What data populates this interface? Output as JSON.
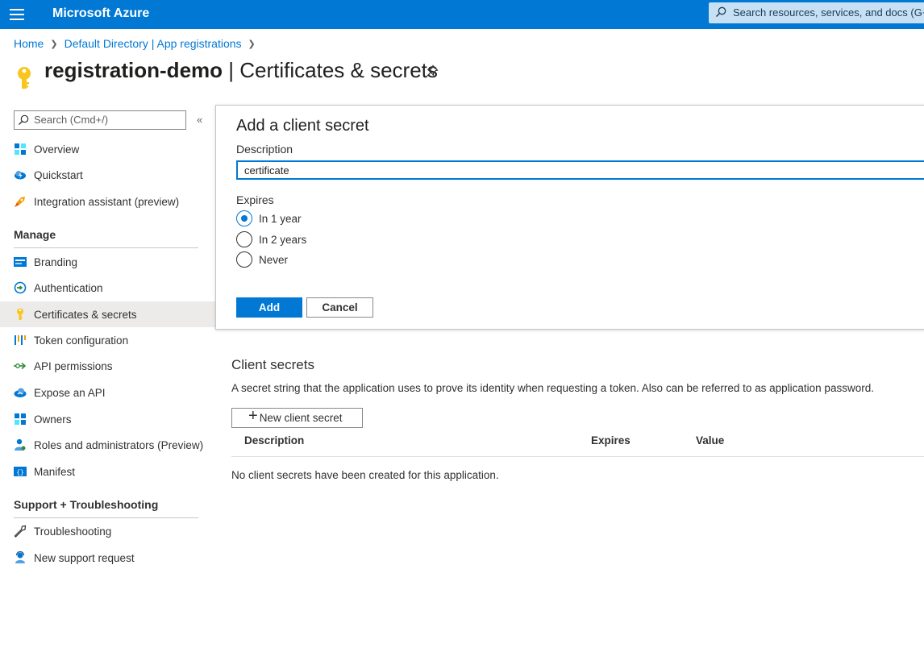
{
  "topbar": {
    "brand": "Microsoft Azure",
    "search_placeholder": "Search resources, services, and docs (G+/)"
  },
  "breadcrumb": [
    "Home",
    "Default Directory | App registrations"
  ],
  "header": {
    "app_name": "registration-demo",
    "separator": "|",
    "page_name": "Certificates & secrets"
  },
  "sidebar": {
    "search_placeholder": "Search (Cmd+/)",
    "collapse_glyph": "«",
    "top_items": [
      {
        "label": "Overview",
        "icon": "overview-grid-icon"
      },
      {
        "label": "Quickstart",
        "icon": "cloud-lightning-icon"
      },
      {
        "label": "Integration assistant (preview)",
        "icon": "rocket-icon"
      }
    ],
    "manage_header": "Manage",
    "manage_items": [
      {
        "label": "Branding",
        "icon": "branding-icon"
      },
      {
        "label": "Authentication",
        "icon": "authentication-icon"
      },
      {
        "label": "Certificates & secrets",
        "icon": "key-icon",
        "active": true
      },
      {
        "label": "Token configuration",
        "icon": "token-bars-icon"
      },
      {
        "label": "API permissions",
        "icon": "api-arrow-icon"
      },
      {
        "label": "Expose an API",
        "icon": "cloud-api-icon"
      },
      {
        "label": "Owners",
        "icon": "owners-grid-icon"
      },
      {
        "label": "Roles and administrators (Preview)",
        "icon": "person-badge-icon"
      },
      {
        "label": "Manifest",
        "icon": "manifest-icon"
      }
    ],
    "support_header": "Support + Troubleshooting",
    "support_items": [
      {
        "label": "Troubleshooting",
        "icon": "wrench-icon"
      },
      {
        "label": "New support request",
        "icon": "support-person-icon"
      }
    ]
  },
  "panel": {
    "title": "Add a client secret",
    "description_label": "Description",
    "description_value": "certificate",
    "expires_label": "Expires",
    "options": [
      {
        "label": "In 1 year",
        "checked": true
      },
      {
        "label": "In 2 years",
        "checked": false
      },
      {
        "label": "Never",
        "checked": false
      }
    ],
    "add_label": "Add",
    "cancel_label": "Cancel"
  },
  "client_secrets": {
    "title": "Client secrets",
    "description": "A secret string that the application uses to prove its identity when requesting a token. Also can be referred to as application password.",
    "new_button": "New client secret",
    "columns": [
      "Description",
      "Expires",
      "Value"
    ],
    "empty_message": "No client secrets have been created for this application."
  },
  "colors": {
    "accent": "#0078d4",
    "active_nav_bg": "#edebe9"
  }
}
